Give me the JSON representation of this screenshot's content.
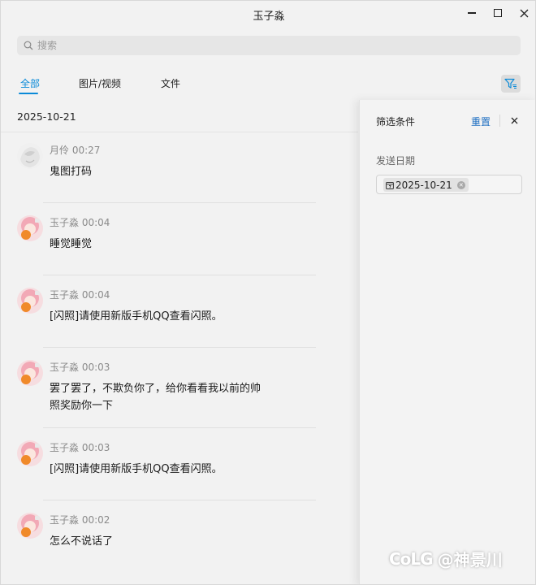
{
  "window": {
    "title": "玉子淼",
    "controls": {
      "minimize": "minimize-icon",
      "maximize": "maximize-icon",
      "close": "close-icon"
    }
  },
  "search": {
    "placeholder": "搜索",
    "value": ""
  },
  "tabs": [
    {
      "label": "全部",
      "active": true
    },
    {
      "label": "图片/视频",
      "active": false
    },
    {
      "label": "文件",
      "active": false
    }
  ],
  "filter_button": {
    "icon": "filter-icon",
    "active_color": "#0a8ad8"
  },
  "date_header": "2025-10-21",
  "messages": [
    {
      "sender": "月伶",
      "time": "00:27",
      "text": "鬼图打码",
      "avatar": "avatar-moon"
    },
    {
      "sender": "玉子淼",
      "time": "00:04",
      "text": "睡觉睡觉",
      "avatar": "avatar-pink"
    },
    {
      "sender": "玉子淼",
      "time": "00:04",
      "text": "[闪照]请使用新版手机QQ查看闪照。",
      "avatar": "avatar-pink"
    },
    {
      "sender": "玉子淼",
      "time": "00:03",
      "text_lines": [
        "罢了罢了，不欺负你了，给你看看我以前的帅",
        "照奖励你一下"
      ],
      "avatar": "avatar-pink"
    },
    {
      "sender": "玉子淼",
      "time": "00:03",
      "text": "[闪照]请使用新版手机QQ查看闪照。",
      "avatar": "avatar-pink"
    },
    {
      "sender": "玉子淼",
      "time": "00:02",
      "text": "怎么不说话了",
      "avatar": "avatar-pink"
    }
  ],
  "filter_panel": {
    "title": "筛选条件",
    "reset_label": "重置",
    "close_icon": "close-icon",
    "section_label": "发送日期",
    "date_chip": "2025-10-21",
    "chip_icon": "calendar-icon",
    "chip_remove_icon": "clear-icon"
  },
  "watermark": {
    "logo": "CoLG",
    "text": "@神景川"
  },
  "colors": {
    "accent": "#0a8ad8",
    "link": "#1f6fc2",
    "background": "#f2f2f2"
  }
}
